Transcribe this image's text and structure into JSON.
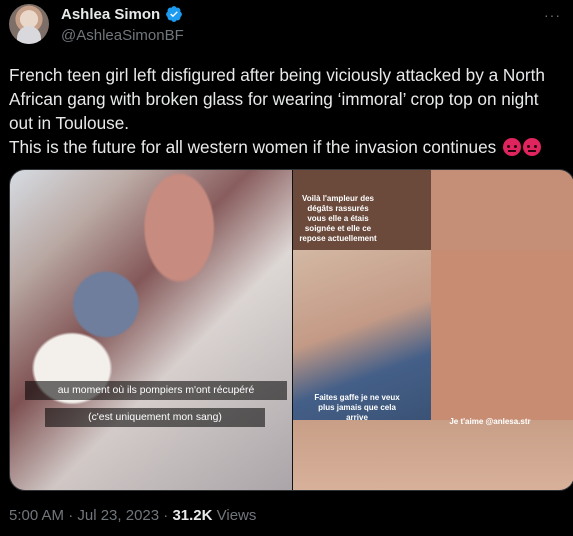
{
  "author": {
    "name": "Ashlea Simon",
    "handle": "@AshleaSimonBF"
  },
  "tweet": {
    "text_line1": "French teen girl left disfigured after being viciously attacked by a North African gang with broken glass for wearing ‘immoral’ crop top on night out in Toulouse.",
    "text_line2": "This is the future for all western women if the invasion continues"
  },
  "media": {
    "left_caption_1": "au moment où ils pompiers m'ont récupéré",
    "left_caption_2": "(c'est uniquement mon sang)",
    "right_caption_1": "Voilà l'ampleur des dégâts rassurés vous elle a étais soignée et elle ce repose actuellement",
    "right_caption_2": "Faites gaffe je ne veux plus jamais que cela arrive",
    "right_caption_3": "Je t'aime @anlesa.str"
  },
  "footer": {
    "time": "5:00 AM · Jul 23, 2023 · ",
    "views_count": "31.2K",
    "views_label": " Views"
  },
  "icons": {
    "verified": "verified-badge-icon",
    "more": "more-options-icon"
  },
  "colors": {
    "background": "#000000",
    "text": "#e7e9ea",
    "muted": "#71767b",
    "verified": "#1d9bf0"
  }
}
